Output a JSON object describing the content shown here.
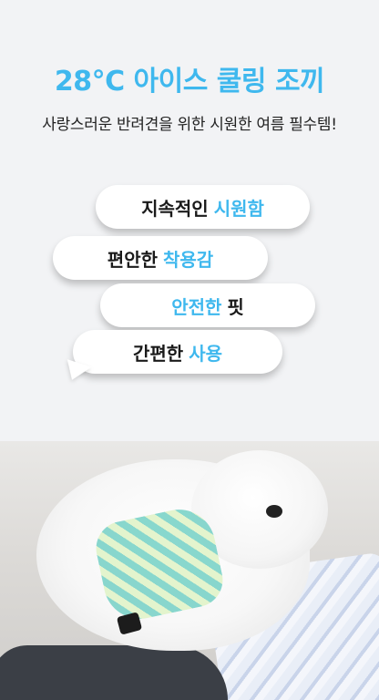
{
  "header": {
    "title": "28°C 아이스 쿨링 조끼",
    "subtitle": "사랑스러운 반려견을 위한 시원한 여름 필수템!"
  },
  "bubbles": [
    {
      "text": "지속적인",
      "highlight": "시원함"
    },
    {
      "text": "편안한",
      "highlight": "착용감"
    },
    {
      "text": "안전한",
      "highlight": "핏"
    },
    {
      "text": "간편한",
      "highlight": "사용"
    }
  ],
  "colors": {
    "accent": "#3fb8ee",
    "background": "#f2f3f5"
  }
}
